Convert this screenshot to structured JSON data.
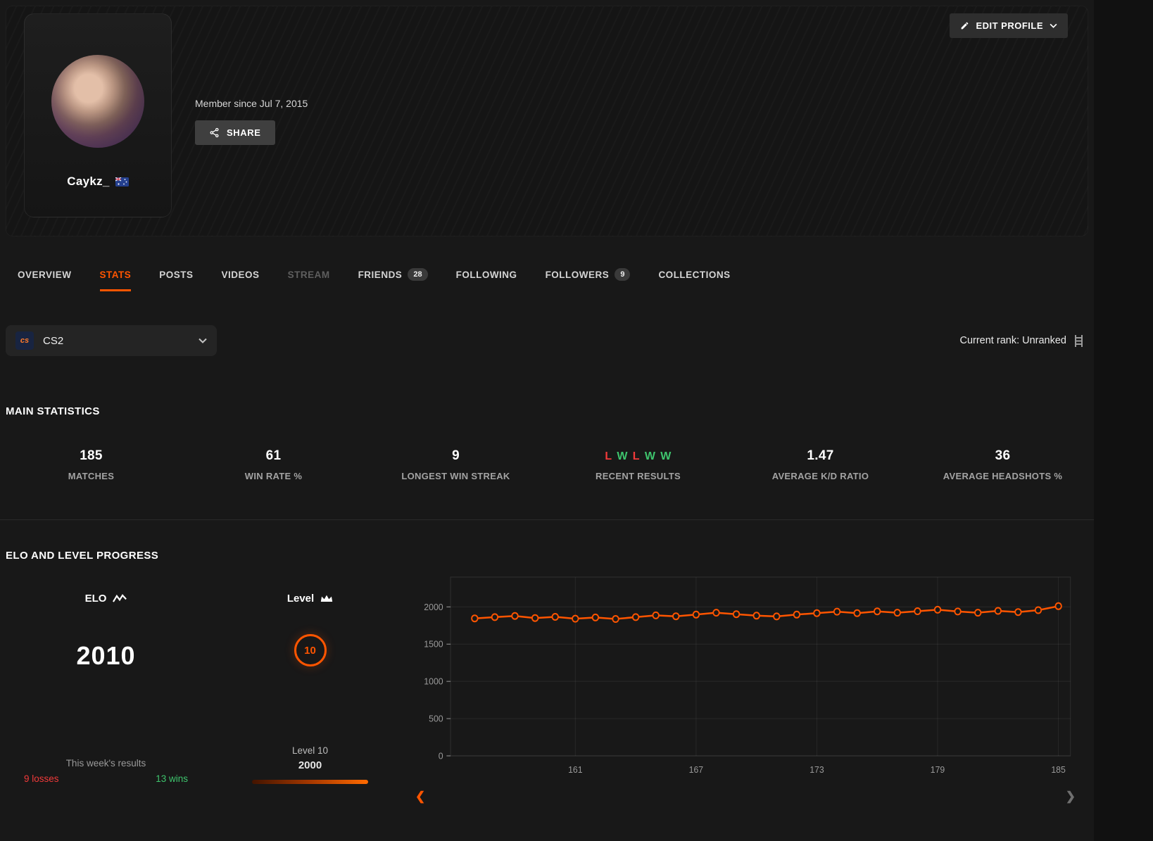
{
  "header": {
    "username": "Caykz_",
    "country": "Australia",
    "member_since": "Member since Jul 7, 2015",
    "share_label": "SHARE",
    "edit_profile_label": "EDIT PROFILE"
  },
  "tabs": [
    {
      "label": "OVERVIEW",
      "state": "normal"
    },
    {
      "label": "STATS",
      "state": "active"
    },
    {
      "label": "POSTS",
      "state": "normal"
    },
    {
      "label": "VIDEOS",
      "state": "normal"
    },
    {
      "label": "STREAM",
      "state": "disabled"
    },
    {
      "label": "FRIENDS",
      "state": "normal",
      "badge": "28"
    },
    {
      "label": "FOLLOWING",
      "state": "normal"
    },
    {
      "label": "FOLLOWERS",
      "state": "normal",
      "badge": "9"
    },
    {
      "label": "COLLECTIONS",
      "state": "normal"
    }
  ],
  "game_selector": {
    "selected": "CS2",
    "icon": "cs2-game-icon"
  },
  "current_rank": {
    "label": "Current rank: Unranked",
    "icon": "ladder-icon"
  },
  "main_statistics": {
    "title": "MAIN STATISTICS",
    "stats": [
      {
        "value": "185",
        "label": "MATCHES"
      },
      {
        "value": "61",
        "label": "WIN RATE %"
      },
      {
        "value": "9",
        "label": "LONGEST WIN STREAK"
      },
      {
        "value": "L W L W W",
        "label": "RECENT RESULTS",
        "results": [
          "L",
          "W",
          "L",
          "W",
          "W"
        ]
      },
      {
        "value": "1.47",
        "label": "AVERAGE K/D RATIO"
      },
      {
        "value": "36",
        "label": "AVERAGE HEADSHOTS %"
      }
    ]
  },
  "elo_section": {
    "title": "ELO AND LEVEL PROGRESS",
    "elo_label": "ELO",
    "elo_icon": "line-graph-icon",
    "elo_value": "2010",
    "week_results_label": "This week's results",
    "losses": "9 losses",
    "wins": "13 wins",
    "level_label": "Level",
    "level_icon": "crown-icon",
    "level_badge": "10",
    "level_text": "Level 10",
    "level_elo": "2000",
    "nav_left_icon": "chevron-left-icon",
    "nav_right_icon": "chevron-right-icon"
  },
  "colors": {
    "accent": "#ff5500",
    "win": "#3ec46d",
    "loss": "#f23a3a"
  },
  "chart_data": {
    "type": "line",
    "title": "ELO progress by match number",
    "x": [
      156,
      157,
      158,
      159,
      160,
      161,
      162,
      163,
      164,
      165,
      166,
      167,
      168,
      169,
      170,
      171,
      172,
      173,
      174,
      175,
      176,
      177,
      178,
      179,
      180,
      181,
      182,
      183,
      184,
      185
    ],
    "values": [
      1845,
      1862,
      1878,
      1850,
      1866,
      1842,
      1858,
      1838,
      1862,
      1886,
      1874,
      1896,
      1922,
      1902,
      1882,
      1872,
      1896,
      1916,
      1936,
      1916,
      1940,
      1922,
      1942,
      1962,
      1938,
      1922,
      1946,
      1930,
      1956,
      2010
    ],
    "x_ticks": [
      161,
      167,
      173,
      179,
      185
    ],
    "y_ticks": [
      0,
      500,
      1000,
      1500,
      2000
    ],
    "xlim": [
      154.8,
      185.6
    ],
    "ylim": [
      0,
      2400
    ],
    "xlabel": "",
    "ylabel": "",
    "grid": true,
    "legend_position": "none",
    "line_color": "#ff5500",
    "marker": "open-circle"
  }
}
